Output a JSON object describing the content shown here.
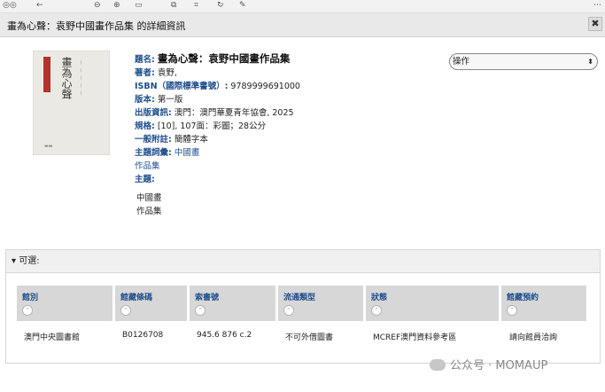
{
  "window": {
    "title": "畫為心聲：袁野中國畫作品集 的詳細資訊",
    "close_label": "✖"
  },
  "book": {
    "title_label": "題名:",
    "title": "畫為心聲：袁野中國畫作品集",
    "author_label": "著者:",
    "author": "袁野,",
    "isbn_label": "ISBN（國際標準書號）:",
    "isbn": "9789999691000",
    "edition_label": "版本:",
    "edition": "第一版",
    "pub_label": "出版資訊:",
    "pub": "澳門：澳門華夏青年協會, 2025",
    "spec_label": "規格:",
    "spec": "[10], 107面：彩圖；28公分",
    "note_label": "一般附註:",
    "note": "簡體字本",
    "subject_terms_label": "主題詞彙:",
    "subject_term_1": "中國畫",
    "subject_term_2": "作品集",
    "subject_label": "主題:",
    "subject_list": [
      "中國畫",
      "作品集"
    ],
    "cover": {
      "calligraphy": "畫為心聲"
    }
  },
  "actions": {
    "label": "操作"
  },
  "holdings": {
    "section_label": "可選:",
    "columns": [
      "館別",
      "館藏條碼",
      "索書號",
      "流通類型",
      "狀態",
      "館藏預約"
    ],
    "rows": [
      [
        "澳門中央圖書館",
        "B0126708",
        "945.6 876 c.2",
        "不可外借圖書",
        "MCREF澳門資料參考區",
        "請向館員洽詢"
      ]
    ]
  },
  "watermark": {
    "text": "公众号 · MOMAUP"
  }
}
